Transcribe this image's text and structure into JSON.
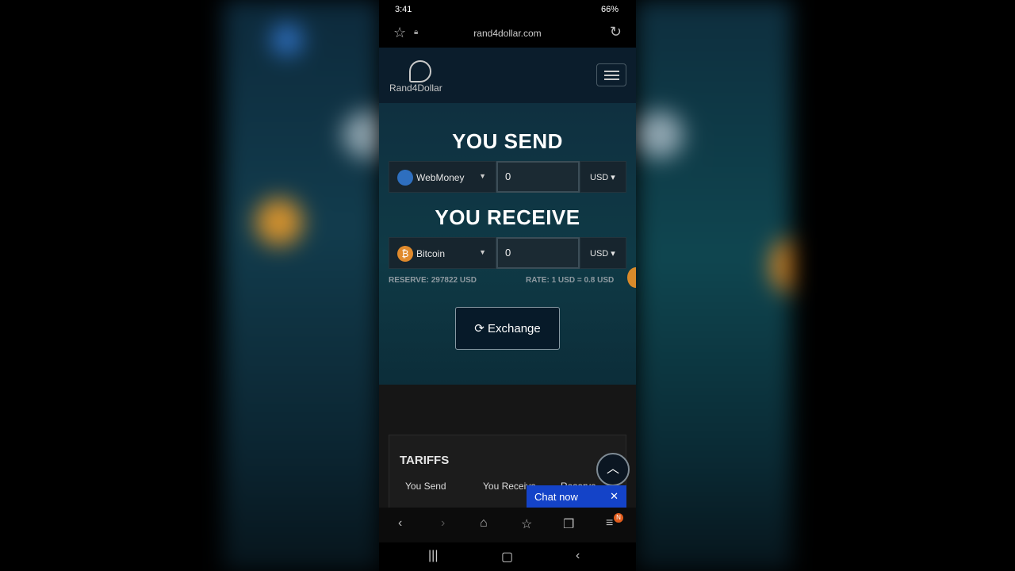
{
  "status_bar": {
    "time": "3:41",
    "icons_left": "bell, recording",
    "signal_battery": "66%"
  },
  "browser": {
    "url": "rand4dollar.com",
    "icons": [
      "star-icon",
      "lock-icon",
      "reload-icon"
    ]
  },
  "site": {
    "logo_text": "Rand4Dollar"
  },
  "exchange": {
    "send_title": "YOU SEND",
    "receive_title": "YOU RECEIVE",
    "send_currency": "WebMoney",
    "send_amount": "0",
    "send_unit": "USD",
    "receive_currency": "Bitcoin",
    "receive_amount": "0",
    "receive_unit": "USD",
    "reserve": "RESERVE: 297822 USD",
    "rate": "RATE: 1 USD = 0.8 USD",
    "button_label": "Exchange"
  },
  "tariffs": {
    "title": "TARIFFS",
    "columns": [
      "You Send",
      "You Receive",
      "Reserve"
    ]
  },
  "chat": {
    "label": "Chat now"
  },
  "navbar": {
    "badge": "N"
  },
  "colors": {
    "chat": "#1443c8",
    "bitcoin": "#e08a2c",
    "webmoney": "#2e6fbf",
    "header": "#0b1d2c"
  }
}
